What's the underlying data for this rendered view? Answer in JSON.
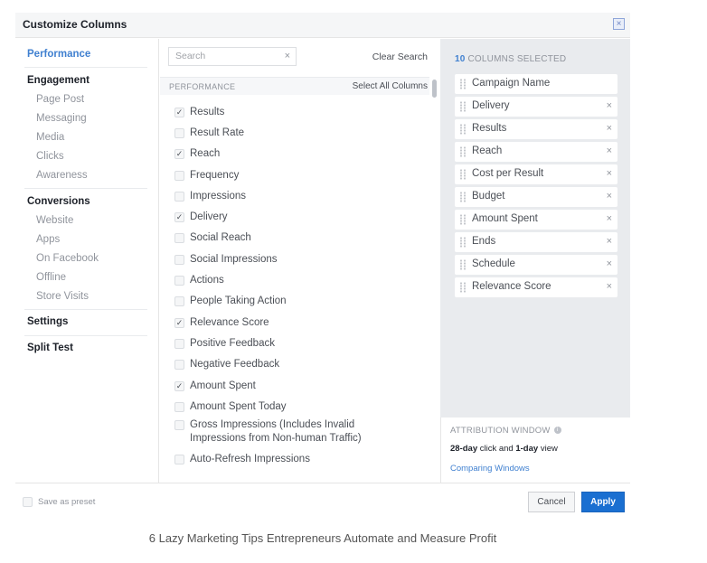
{
  "dialog": {
    "title": "Customize Columns",
    "close_icon": "close-icon"
  },
  "nav": {
    "groups": [
      {
        "label": "Performance",
        "active": true,
        "items": []
      },
      {
        "label": "Engagement",
        "active": false,
        "items": [
          "Page Post",
          "Messaging",
          "Media",
          "Clicks",
          "Awareness"
        ]
      },
      {
        "label": "Conversions",
        "active": false,
        "items": [
          "Website",
          "Apps",
          "On Facebook",
          "Offline",
          "Store Visits"
        ]
      },
      {
        "label": "Settings",
        "active": false,
        "items": []
      },
      {
        "label": "Split Test",
        "active": false,
        "items": []
      }
    ]
  },
  "search": {
    "placeholder": "Search",
    "value": "",
    "clear_icon": "×",
    "clear_label": "Clear Search"
  },
  "section": {
    "label": "PERFORMANCE",
    "select_all_label": "Select All Columns"
  },
  "metrics": [
    {
      "label": "Results",
      "checked": true
    },
    {
      "label": "Result Rate",
      "checked": false
    },
    {
      "label": "Reach",
      "checked": true
    },
    {
      "label": "Frequency",
      "checked": false
    },
    {
      "label": "Impressions",
      "checked": false
    },
    {
      "label": "Delivery",
      "checked": true
    },
    {
      "label": "Social Reach",
      "checked": false
    },
    {
      "label": "Social Impressions",
      "checked": false
    },
    {
      "label": "Actions",
      "checked": false
    },
    {
      "label": "People Taking Action",
      "checked": false
    },
    {
      "label": "Relevance Score",
      "checked": true
    },
    {
      "label": "Positive Feedback",
      "checked": false
    },
    {
      "label": "Negative Feedback",
      "checked": false
    },
    {
      "label": "Amount Spent",
      "checked": true
    },
    {
      "label": "Amount Spent Today",
      "checked": false
    },
    {
      "label": "Gross Impressions (Includes Invalid Impressions from Non-human Traffic)",
      "checked": false
    },
    {
      "label": "Auto-Refresh Impressions",
      "checked": false
    }
  ],
  "selected": {
    "count": "10",
    "header_label": "COLUMNS SELECTED",
    "items": [
      {
        "label": "Campaign Name",
        "removable": false
      },
      {
        "label": "Delivery",
        "removable": true
      },
      {
        "label": "Results",
        "removable": true
      },
      {
        "label": "Reach",
        "removable": true
      },
      {
        "label": "Cost per Result",
        "removable": true
      },
      {
        "label": "Budget",
        "removable": true
      },
      {
        "label": "Amount Spent",
        "removable": true
      },
      {
        "label": "Ends",
        "removable": true
      },
      {
        "label": "Schedule",
        "removable": true
      },
      {
        "label": "Relevance Score",
        "removable": true
      }
    ]
  },
  "attribution": {
    "title": "ATTRIBUTION WINDOW",
    "info_icon": "i",
    "value_part1": "28-day",
    "value_part2": " click and ",
    "value_part3": "1-day",
    "value_part4": " view",
    "link": "Comparing Windows"
  },
  "footer": {
    "preset_label": "Save as preset",
    "preset_checked": false,
    "cancel_label": "Cancel",
    "apply_label": "Apply"
  },
  "caption": "6 Lazy Marketing Tips Entrepreneurs Automate and Measure Profit",
  "colors": {
    "accent": "#4080d0",
    "apply_button": "#1a6fd1",
    "panel_bg": "#e9ebee"
  }
}
